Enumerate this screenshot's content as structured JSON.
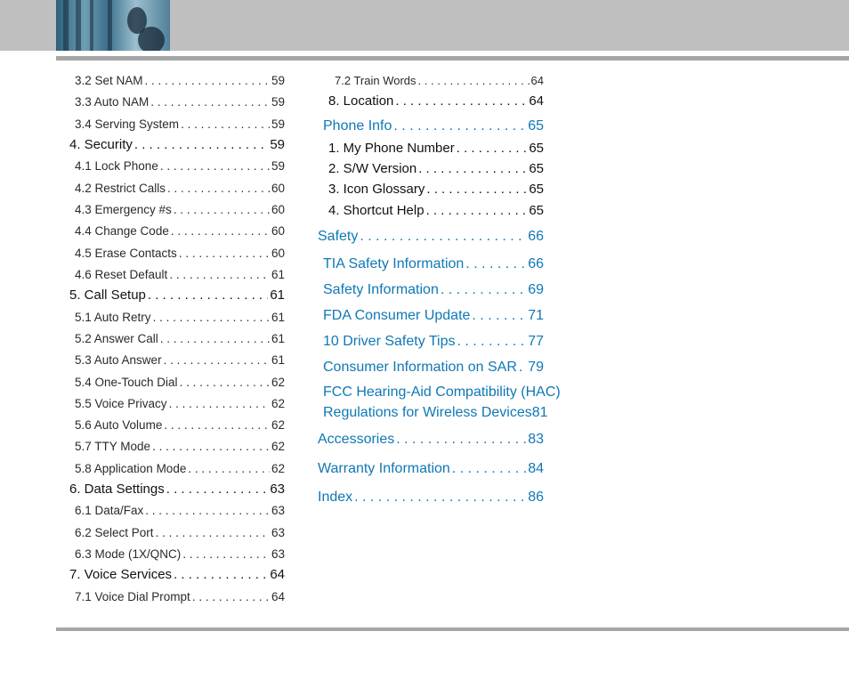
{
  "left_column": [
    {
      "title": "3.2 Set NAM",
      "page": "59",
      "level": "sub"
    },
    {
      "title": "3.3 Auto NAM",
      "page": "59",
      "level": "sub"
    },
    {
      "title": "3.4 Serving System",
      "page": "59",
      "level": "sub"
    },
    {
      "title": "4. Security",
      "page": "59",
      "level": "main"
    },
    {
      "title": "4.1 Lock Phone",
      "page": "59",
      "level": "sub"
    },
    {
      "title": "4.2 Restrict Calls",
      "page": "60",
      "level": "sub"
    },
    {
      "title": "4.3 Emergency #s",
      "page": "60",
      "level": "sub"
    },
    {
      "title": "4.4 Change Code",
      "page": "60",
      "level": "sub"
    },
    {
      "title": "4.5 Erase Contacts",
      "page": "60",
      "level": "sub"
    },
    {
      "title": "4.6 Reset Default",
      "page": "61",
      "level": "sub"
    },
    {
      "title": "5. Call Setup",
      "page": "61",
      "level": "main"
    },
    {
      "title": "5.1 Auto Retry",
      "page": "61",
      "level": "sub"
    },
    {
      "title": "5.2 Answer Call",
      "page": "61",
      "level": "sub"
    },
    {
      "title": "5.3 Auto Answer",
      "page": "61",
      "level": "sub"
    },
    {
      "title": "5.4 One-Touch Dial",
      "page": "62",
      "level": "sub"
    },
    {
      "title": "5.5 Voice Privacy",
      "page": "62",
      "level": "sub"
    },
    {
      "title": "5.6 Auto Volume",
      "page": "62",
      "level": "sub"
    },
    {
      "title": "5.7 TTY Mode",
      "page": "62",
      "level": "sub"
    },
    {
      "title": "5.8 Application Mode",
      "page": "62",
      "level": "sub"
    },
    {
      "title": "6. Data Settings",
      "page": "63",
      "level": "main"
    },
    {
      "title": "6.1 Data/Fax",
      "page": "63",
      "level": "sub"
    },
    {
      "title": "6.2 Select Port",
      "page": "63",
      "level": "sub"
    },
    {
      "title": "6.3 Mode (1X/QNC)",
      "page": "63",
      "level": "sub"
    },
    {
      "title": "7. Voice Services",
      "page": "64",
      "level": "main"
    },
    {
      "title": "7.1 Voice Dial Prompt",
      "page": "64",
      "level": "sub"
    }
  ],
  "right_column": [
    {
      "title": "7.2 Train Words",
      "page": "64",
      "level": "sub"
    },
    {
      "title": "8. Location",
      "page": "64",
      "level": "main"
    },
    {
      "title": "Phone Info",
      "page": "65",
      "level": "blue-sub"
    },
    {
      "title": "1. My Phone Number",
      "page": "65",
      "level": "main"
    },
    {
      "title": "2. S/W Version",
      "page": "65",
      "level": "main"
    },
    {
      "title": "3. Icon Glossary",
      "page": "65",
      "level": "main"
    },
    {
      "title": "4. Shortcut Help",
      "page": "65",
      "level": "main"
    },
    {
      "title": "Safety",
      "page": "66",
      "level": "blue-main"
    },
    {
      "title": "TIA Safety Information",
      "page": "66",
      "level": "blue-sub"
    },
    {
      "title": "Safety Information",
      "page": "69",
      "level": "blue-sub"
    },
    {
      "title": "FDA Consumer Update",
      "page": "71",
      "level": "blue-sub"
    },
    {
      "title": "10 Driver Safety Tips",
      "page": "77",
      "level": "blue-sub"
    },
    {
      "title": "Consumer Information on SAR",
      "page": "79",
      "level": "blue-sub"
    }
  ],
  "hac_entry": {
    "line1": "FCC Hearing-Aid Compatibility (HAC)",
    "line2": "Regulations for Wireless Devices",
    "page": "81"
  },
  "right_column_end": [
    {
      "title": "Accessories",
      "page": "83",
      "level": "blue-main"
    },
    {
      "title": "Warranty Information",
      "page": "84",
      "level": "blue-main"
    },
    {
      "title": "Index",
      "page": "86",
      "level": "blue-main"
    }
  ],
  "colors": {
    "link_blue": "#0f78b4",
    "header_gray": "#bfbfbf",
    "rule_gray": "#a6a6a6"
  }
}
